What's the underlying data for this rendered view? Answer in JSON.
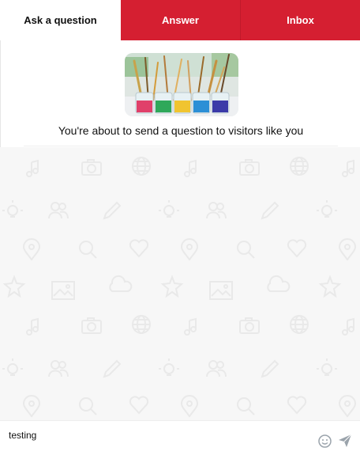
{
  "tabs": {
    "ask": "Ask a question",
    "answer": "Answer",
    "inbox": "Inbox"
  },
  "header": {
    "text": "You're about to send a question to visitors like you",
    "image": "paint-brushes-in-jars-photo"
  },
  "composer": {
    "value": "testing",
    "emoji_icon": "smiley-icon",
    "send_icon": "paper-plane-icon"
  },
  "colors": {
    "brand_red": "#d51f31",
    "chat_background": "#f7f7f7",
    "icon_gray": "#9aa3ab"
  }
}
